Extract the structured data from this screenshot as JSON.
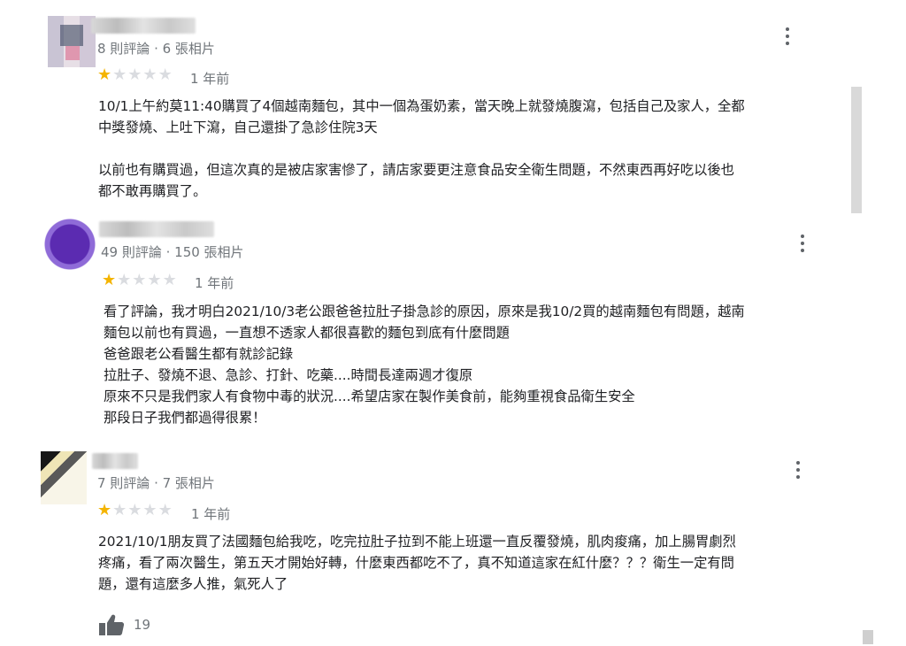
{
  "reviews": [
    {
      "meta": "8 則評論 · 6 張相片",
      "rating": 1,
      "time": "1 年前",
      "lines": [
        "10/1上午約莫11:40購買了4個越南麵包，其中一個為蛋奶素，當天晚上就發燒腹瀉，包括自己及家人，全都",
        "中獎發燒、上吐下瀉，自己還掛了急診住院3天",
        "",
        "以前也有購買過，但這次真的是被店家害慘了，請店家要更注意食品安全衛生問題，不然東西再好吃以後也",
        "都不敢再購買了。"
      ]
    },
    {
      "meta": "49 則評論 · 150 張相片",
      "rating": 1,
      "time": "1 年前",
      "lines": [
        "看了評論，我才明白2021/10/3老公跟爸爸拉肚子掛急診的原因，原來是我10/2買的越南麵包有問題，越南",
        "麵包以前也有買過，一直想不透家人都很喜歡的麵包到底有什麼問題",
        "爸爸跟老公看醫生都有就診記錄",
        "拉肚子、發燒不退、急診、打針、吃藥....時間長達兩週才復原",
        "原來不只是我們家人有食物中毒的狀況....希望店家在製作美食前，能夠重視食品衛生安全",
        "那段日子我們都過得很累！"
      ]
    },
    {
      "meta": "7 則評論 · 7 張相片",
      "rating": 1,
      "time": "1 年前",
      "lines": [
        "2021/10/1朋友買了法國麵包給我吃，吃完拉肚子拉到不能上班還一直反覆發燒，肌肉痠痛，加上腸胃劇烈",
        "疼痛，看了兩次醫生，第五天才開始好轉，什麼東西都吃不了，真不知道這家在紅什麼？？？衛生一定有問",
        "題，還有這麼多人推，氣死人了"
      ],
      "likes": "19"
    }
  ],
  "icons": {
    "menu": "more-vert-icon",
    "like": "thumb-up-icon",
    "star": "star-icon"
  },
  "colors": {
    "star_on": "#f4b400",
    "star_off": "#dadce0",
    "muted_text": "#70757a"
  }
}
